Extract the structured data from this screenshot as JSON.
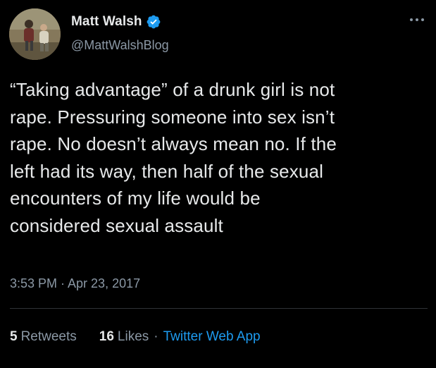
{
  "author": {
    "display_name": "Matt Walsh",
    "handle": "@MattWalshBlog",
    "verified": true
  },
  "icons": {
    "avatar": "profile-photo",
    "verified": "verified-badge-icon",
    "more": "more-options-icon"
  },
  "tweet": {
    "lines": [
      "“Taking advantage” of a drunk girl is not",
      "rape. Pressuring someone into sex isn’t",
      "rape. No doesn’t always mean no. If the",
      "left had its way, then half of the sexual",
      "encounters of my life would be",
      "considered sexual assault"
    ],
    "timestamp": "3:53 PM · Apr 23, 2017"
  },
  "stats": {
    "retweets_count": "5",
    "retweets_label": "Retweets",
    "likes_count": "16",
    "likes_label": "Likes",
    "separator": "·",
    "source": "Twitter Web App"
  },
  "colors": {
    "background": "#000000",
    "text_primary": "#e7e9ea",
    "text_secondary": "#8b98a5",
    "link": "#1d9bf0",
    "verified_badge": "#1d9bf0",
    "divider": "#2f3336"
  }
}
